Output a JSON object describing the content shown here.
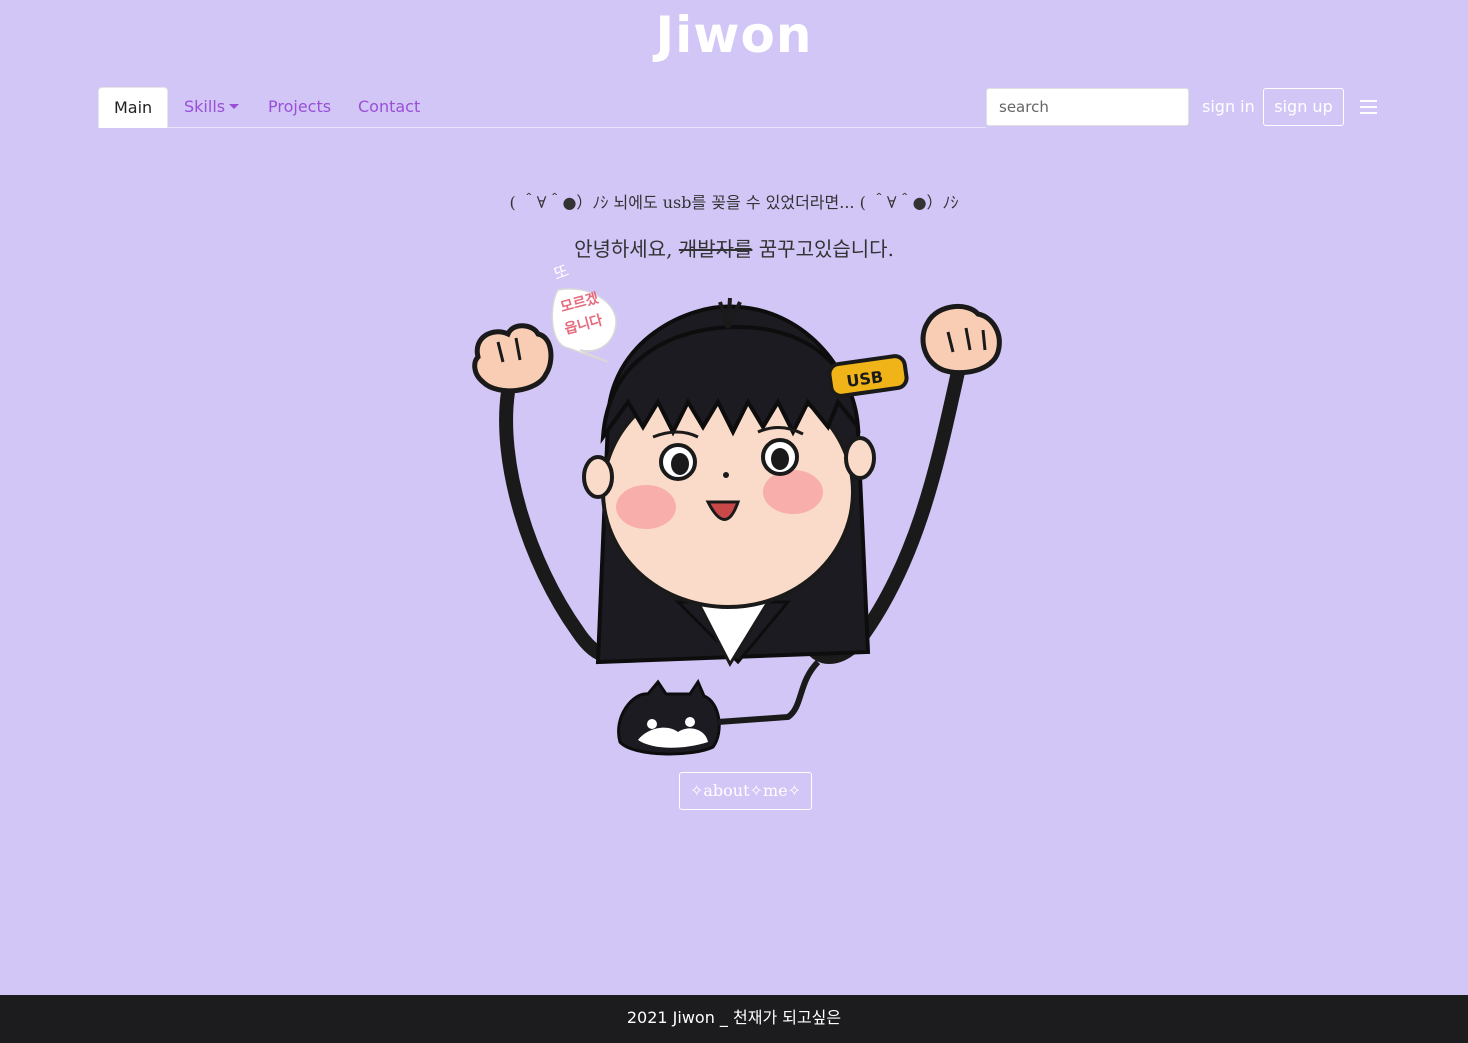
{
  "brand": {
    "title": "Jiwon"
  },
  "nav": {
    "items": [
      {
        "label": "Main"
      },
      {
        "label": "Skills"
      },
      {
        "label": "Projects"
      },
      {
        "label": "Contact"
      }
    ]
  },
  "search": {
    "placeholder": "search"
  },
  "auth": {
    "sign_in": "sign in",
    "sign_up": "sign up"
  },
  "hero": {
    "tagline": "( ＾∀＾●）ﾉｼ 뇌에도 usb를 꽂을 수 있었더라면... ( ＾∀＾●）ﾉｼ",
    "greeting_prefix": "안녕하세요, ",
    "greeting_strike": "개발자를",
    "greeting_suffix": " 꿈꾸고있습니다.",
    "bubble_text_1": "모르겠",
    "bubble_text_2": "읍니다",
    "bubble_extra": "또",
    "usb_label": "USB",
    "about_button": "✧about✧me✧"
  },
  "footer": {
    "text": "2021 Jiwon _ 천재가 되고싶은"
  },
  "colors": {
    "background": "#d2c6f7",
    "nav_link": "#9a4fd6",
    "footer_bg": "#1c1b1e",
    "usb": "#f0b418"
  }
}
